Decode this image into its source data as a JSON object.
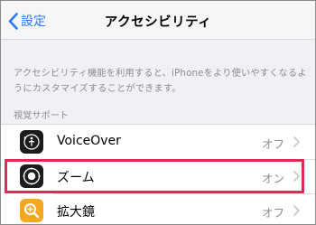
{
  "nav": {
    "back_label": "設定",
    "title": "アクセシビリティ"
  },
  "description": "アクセシビリティ機能を利用すると、iPhoneをより使いやすくなるようにカスタマイズすることができます。",
  "section_header": "視覚サポート",
  "rows": [
    {
      "label": "VoiceOver",
      "value": "オフ",
      "icon": "voiceover-icon",
      "color": "#1c1c1e"
    },
    {
      "label": "ズーム",
      "value": "オン",
      "icon": "zoom-icon",
      "color": "#1c1c1e"
    },
    {
      "label": "拡大鏡",
      "value": "オフ",
      "icon": "magnifier-icon",
      "color": "#f5a623"
    }
  ],
  "colors": {
    "accent": "#2a7cf6",
    "highlight": "#de2b55",
    "background": "#f1f0f5"
  }
}
